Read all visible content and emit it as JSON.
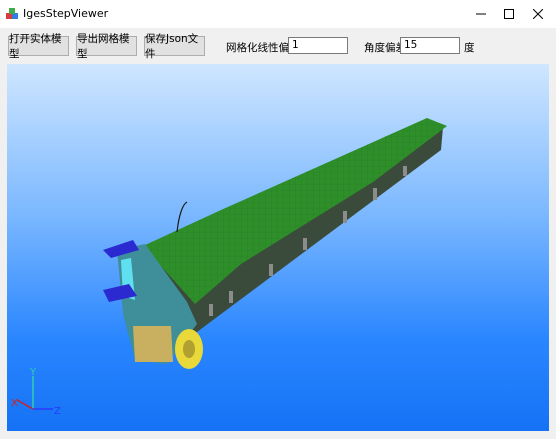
{
  "window": {
    "title": "IgesStepViewer"
  },
  "toolbar": {
    "open_label": "打开实体模型",
    "export_label": "导出网格模型",
    "save_label": "保存Json文件",
    "linear_label": "网格化线性偏差",
    "linear_value": "1",
    "angle_label": "角度偏差",
    "angle_value": "15",
    "angle_unit": "度"
  },
  "axes": {
    "x": "X",
    "y": "Y",
    "z": "Z"
  }
}
